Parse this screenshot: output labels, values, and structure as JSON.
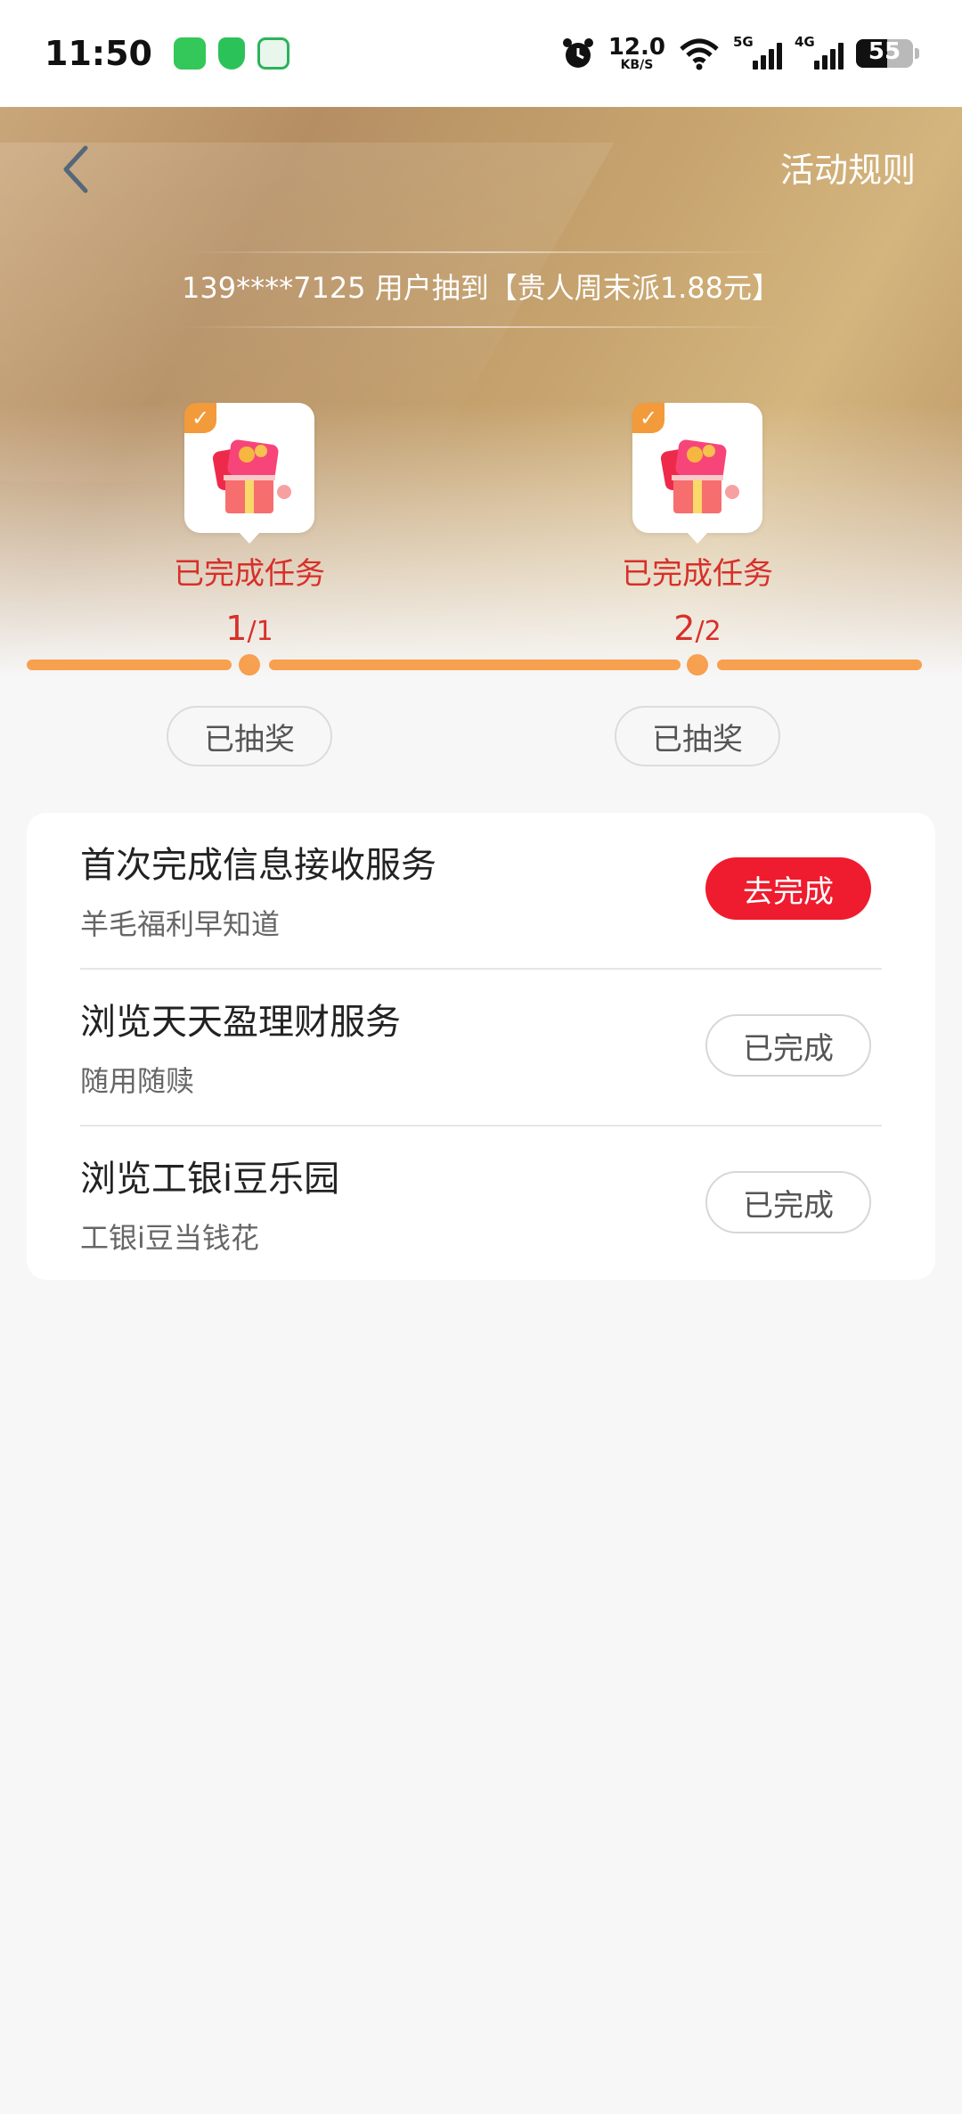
{
  "status_bar": {
    "time": "11:50",
    "net_speed_value": "12.0",
    "net_speed_unit": "KB/S",
    "signal_1_label": "5G",
    "signal_2_label": "4G",
    "battery_level": "55"
  },
  "header": {
    "rules_label": "活动规则",
    "ticker_text": "139****7125 用户抽到【贵人周末派1.88元】"
  },
  "milestones": [
    {
      "status": "已完成任务",
      "progress_done": "1",
      "progress_total": "/1",
      "button_label": "已抽奖"
    },
    {
      "status": "已完成任务",
      "progress_done": "2",
      "progress_total": "/2",
      "button_label": "已抽奖"
    }
  ],
  "tasks": [
    {
      "title": "首次完成信息接收服务",
      "subtitle": "羊毛福利早知道",
      "button_label": "去完成"
    },
    {
      "title": "浏览天天盈理财服务",
      "subtitle": "随用随赎",
      "button_label": "已完成"
    },
    {
      "title": "浏览工银i豆乐园",
      "subtitle": "工银i豆当钱花",
      "button_label": "已完成"
    }
  ],
  "colors": {
    "accent_red": "#ee1c2e",
    "progress_orange": "#f7a050",
    "milestone_red": "#d7302a"
  }
}
